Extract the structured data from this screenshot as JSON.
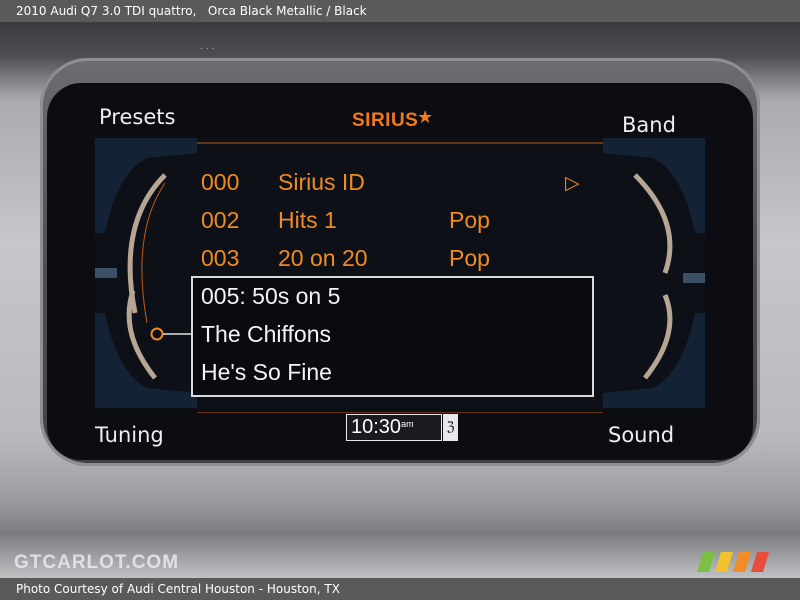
{
  "caption": {
    "title": "2010 Audi Q7 3.0 TDI quattro,",
    "color": "Orca Black Metallic / Black",
    "credit": "Photo Courtesy of Audi Central Houston - Houston, TX"
  },
  "watermark": {
    "text": "GTCARLOT.COM"
  },
  "screen": {
    "top_left": "Presets",
    "top_right": "Band",
    "bottom_left": "Tuning",
    "bottom_right": "Sound",
    "logo_text": "SIRIUS",
    "clock": {
      "time": "10:30",
      "ampm": "am"
    },
    "channels": [
      {
        "number": "000",
        "name": "Sirius ID",
        "genre": ""
      },
      {
        "number": "002",
        "name": "Hits 1",
        "genre": "Pop"
      },
      {
        "number": "003",
        "name": "20 on 20",
        "genre": "Pop"
      }
    ],
    "popup": {
      "line1": "005: 50s on 5",
      "line2": "The Chiffons",
      "line3": "He's So Fine"
    }
  },
  "colors": {
    "accent": "#f08a22",
    "screen_bg": "#0c0d12",
    "caption_bar": "#5a5a5a"
  },
  "icons": [
    "play-icon",
    "bluetooth-icon",
    "sirius-dog-icon"
  ]
}
